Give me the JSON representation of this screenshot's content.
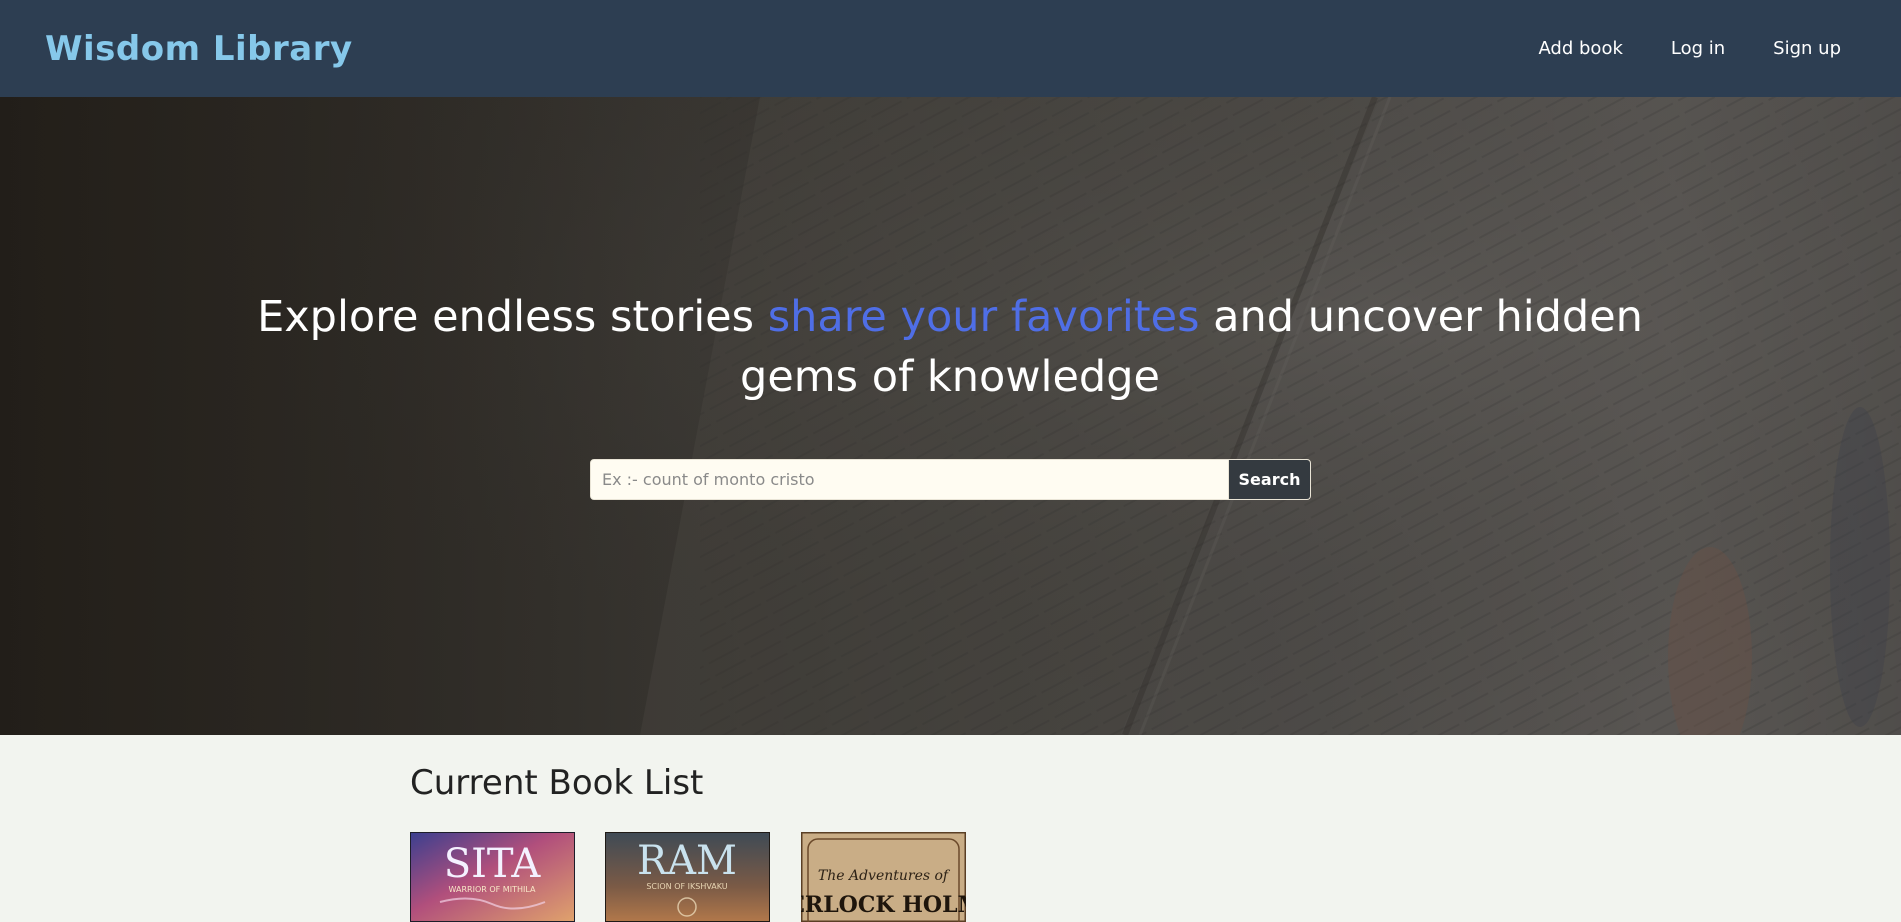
{
  "navbar": {
    "brand": "Wisdom Library",
    "links": [
      "Add book",
      "Log in",
      "Sign up"
    ]
  },
  "hero": {
    "headline_part1": "Explore endless stories ",
    "headline_accent": "share your favorites",
    "headline_part2": " and uncover hidden gems of knowledge",
    "search": {
      "placeholder": "Ex :- count of monto cristo",
      "value": "",
      "button_label": "Search"
    }
  },
  "books": {
    "section_title": "Current Book List",
    "items": [
      {
        "cover_title": "SITA",
        "cover_subtitle": "WARRIOR OF MITHILA"
      },
      {
        "cover_title": "RAM",
        "cover_subtitle": "SCION OF IKSHVAKU"
      },
      {
        "cover_title": "The Adventures of",
        "cover_subtitle": "SHERLOCK HOLMES"
      }
    ]
  },
  "colors": {
    "navbar_bg": "#2d3e52",
    "brand": "#86c8ea",
    "accent": "#4f6ee6",
    "search_button_bg": "#343a40",
    "page_bg": "#f2f4ef"
  }
}
